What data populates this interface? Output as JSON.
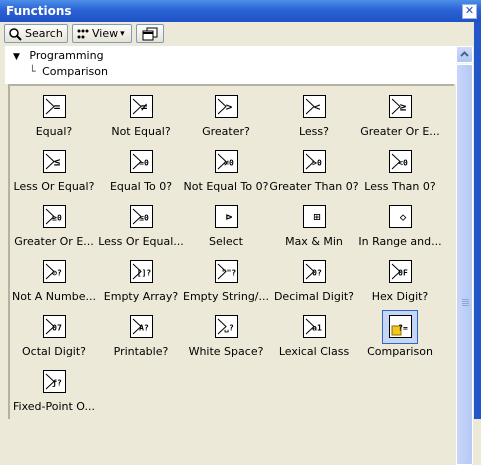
{
  "window": {
    "title": "Functions",
    "close_glyph": "✕"
  },
  "toolbar": {
    "search_label": "Search",
    "view_label": "View",
    "view_arrow": "▾"
  },
  "tree": {
    "expander": "▼",
    "root": "Programming",
    "child_connector": "└",
    "child": "Comparison"
  },
  "palette": {
    "selected": "Comparison",
    "items": [
      {
        "label": "Equal?",
        "icon": "equal-icon",
        "glyph": "="
      },
      {
        "label": "Not Equal?",
        "icon": "not-equal-icon",
        "glyph": "≠"
      },
      {
        "label": "Greater?",
        "icon": "greater-icon",
        "glyph": ">"
      },
      {
        "label": "Less?",
        "icon": "less-icon",
        "glyph": "<"
      },
      {
        "label": "Greater Or E...",
        "icon": "greater-or-equal-icon",
        "glyph": "≥"
      },
      {
        "label": "Less Or Equal?",
        "icon": "less-or-equal-icon",
        "glyph": "≤"
      },
      {
        "label": "Equal To 0?",
        "icon": "equal-to-zero-icon",
        "glyph": "=0"
      },
      {
        "label": "Not Equal To 0?",
        "icon": "not-equal-to-zero-icon",
        "glyph": "≠0"
      },
      {
        "label": "Greater Than 0?",
        "icon": "greater-than-zero-icon",
        "glyph": ">0"
      },
      {
        "label": "Less Than 0?",
        "icon": "less-than-zero-icon",
        "glyph": "<0"
      },
      {
        "label": "Greater Or E...",
        "icon": "greater-or-equal-zero-icon",
        "glyph": "≥0"
      },
      {
        "label": "Less Or Equal...",
        "icon": "less-or-equal-zero-icon",
        "glyph": "≤0"
      },
      {
        "label": "Select",
        "icon": "select-icon",
        "glyph": "⊳"
      },
      {
        "label": "Max & Min",
        "icon": "max-min-icon",
        "glyph": "⊞"
      },
      {
        "label": "In Range and...",
        "icon": "in-range-icon",
        "glyph": "◇"
      },
      {
        "label": "Not A Numbe...",
        "icon": "not-a-number-icon",
        "glyph": "⊘?"
      },
      {
        "label": "Empty Array?",
        "icon": "empty-array-icon",
        "glyph": "[]?"
      },
      {
        "label": "Empty String/...",
        "icon": "empty-string-icon",
        "glyph": "\"\"?"
      },
      {
        "label": "Decimal Digit?",
        "icon": "decimal-digit-icon",
        "glyph": "0?"
      },
      {
        "label": "Hex Digit?",
        "icon": "hex-digit-icon",
        "glyph": "0F"
      },
      {
        "label": "Octal Digit?",
        "icon": "octal-digit-icon",
        "glyph": "07"
      },
      {
        "label": "Printable?",
        "icon": "printable-icon",
        "glyph": "A?"
      },
      {
        "label": "White Space?",
        "icon": "white-space-icon",
        "glyph": "␣?"
      },
      {
        "label": "Lexical Class",
        "icon": "lexical-class-icon",
        "glyph": "a1"
      },
      {
        "label": "Comparison",
        "icon": "comparison-palette-icon",
        "glyph": "?="
      },
      {
        "label": "Fixed-Point O...",
        "icon": "fixed-point-overflow-icon",
        "glyph": "ƒ?"
      }
    ]
  }
}
